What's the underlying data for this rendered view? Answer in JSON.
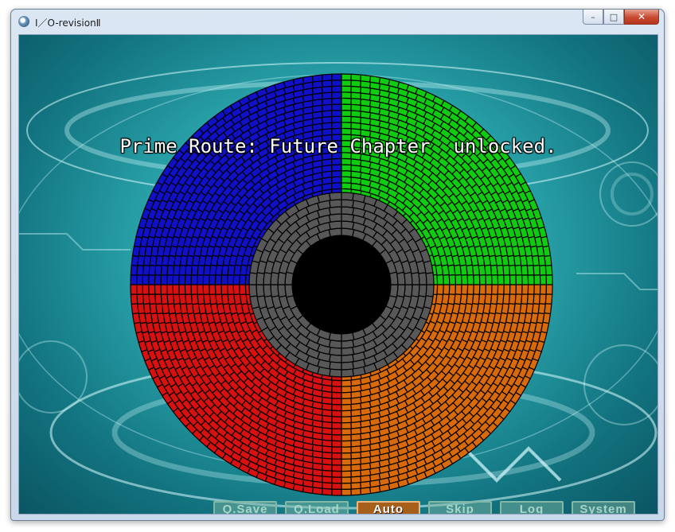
{
  "window": {
    "title": "I／O-revisionⅡ",
    "buttons": {
      "minimize": "–",
      "maximize": "□",
      "close": "✕"
    }
  },
  "scene": {
    "headline": "Prime Route: Future Chapter  unlocked.",
    "disc": {
      "quadrant_colors": {
        "top_left": "#1010c8",
        "top_right": "#10cc10",
        "bottom_right": "#d86a0a",
        "bottom_left": "#d81010",
        "inner_ring": "#585858"
      }
    }
  },
  "menu": {
    "items": [
      {
        "label": "Q.Save",
        "active": false
      },
      {
        "label": "Q.Load",
        "active": false
      },
      {
        "label": "Auto",
        "active": true
      },
      {
        "label": "Skip",
        "active": false
      },
      {
        "label": "Log",
        "active": false
      },
      {
        "label": "System",
        "active": false
      }
    ]
  }
}
